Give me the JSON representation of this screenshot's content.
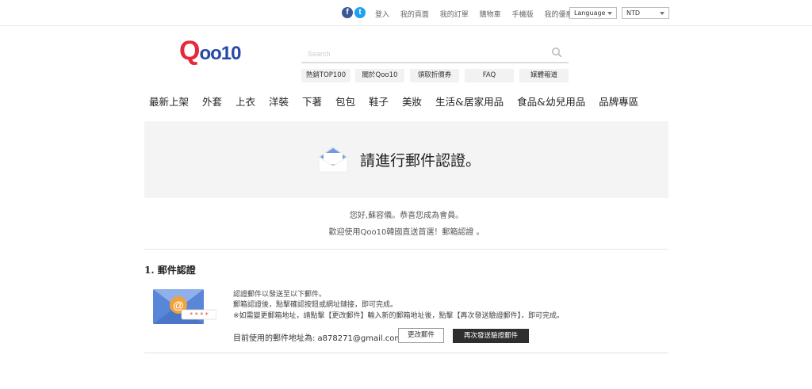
{
  "topbar": {
    "facebook": "f",
    "twitter": "t",
    "links": [
      "登入",
      "我的頁面",
      "我的訂單",
      "購物車",
      "手機版",
      "我的優惠券"
    ],
    "language": "Language",
    "currency": "NTD"
  },
  "logo": {
    "q": "Q",
    "rest": "oo10"
  },
  "search": {
    "placeholder": "Search"
  },
  "quick_links": [
    "熱銷TOP100",
    "關於Qoo10",
    "領取折價券",
    "FAQ",
    "媒體報道"
  ],
  "categories": [
    "最新上架",
    "外套",
    "上衣",
    "洋裝",
    "下著",
    "包包",
    "鞋子",
    "美妝",
    "生活&居家用品",
    "食品&幼兒用品",
    "品牌專區"
  ],
  "banner": {
    "title": "請進行郵件認證。"
  },
  "welcome": {
    "line1": "您好,蘇容儀。恭喜您成為會員。",
    "line2": "歡迎使用Qoo10韓國直送首選！郵箱認證 。"
  },
  "section": {
    "title": "1. 郵件認證",
    "info1": "認證郵件以發送至以下郵件。",
    "info2": "郵箱認證後，點擊確認按鈕或網址鏈接，即可完成。",
    "info3": "※如需變更郵箱地址，請點擊【更改郵件】輸入新的郵箱地址後，點擊【再次發送驗證郵件】，即可完成。",
    "current_label": "目前使用的郵件地址為: a878271@gmail.com",
    "change_button": "更改郵件",
    "resend_button": "再次發送驗證郵件",
    "stars": "* * * *"
  },
  "colors": {
    "logo_red": "#e6283a",
    "logo_blue": "#274aa5",
    "resend_bg": "#2e2e2e"
  }
}
